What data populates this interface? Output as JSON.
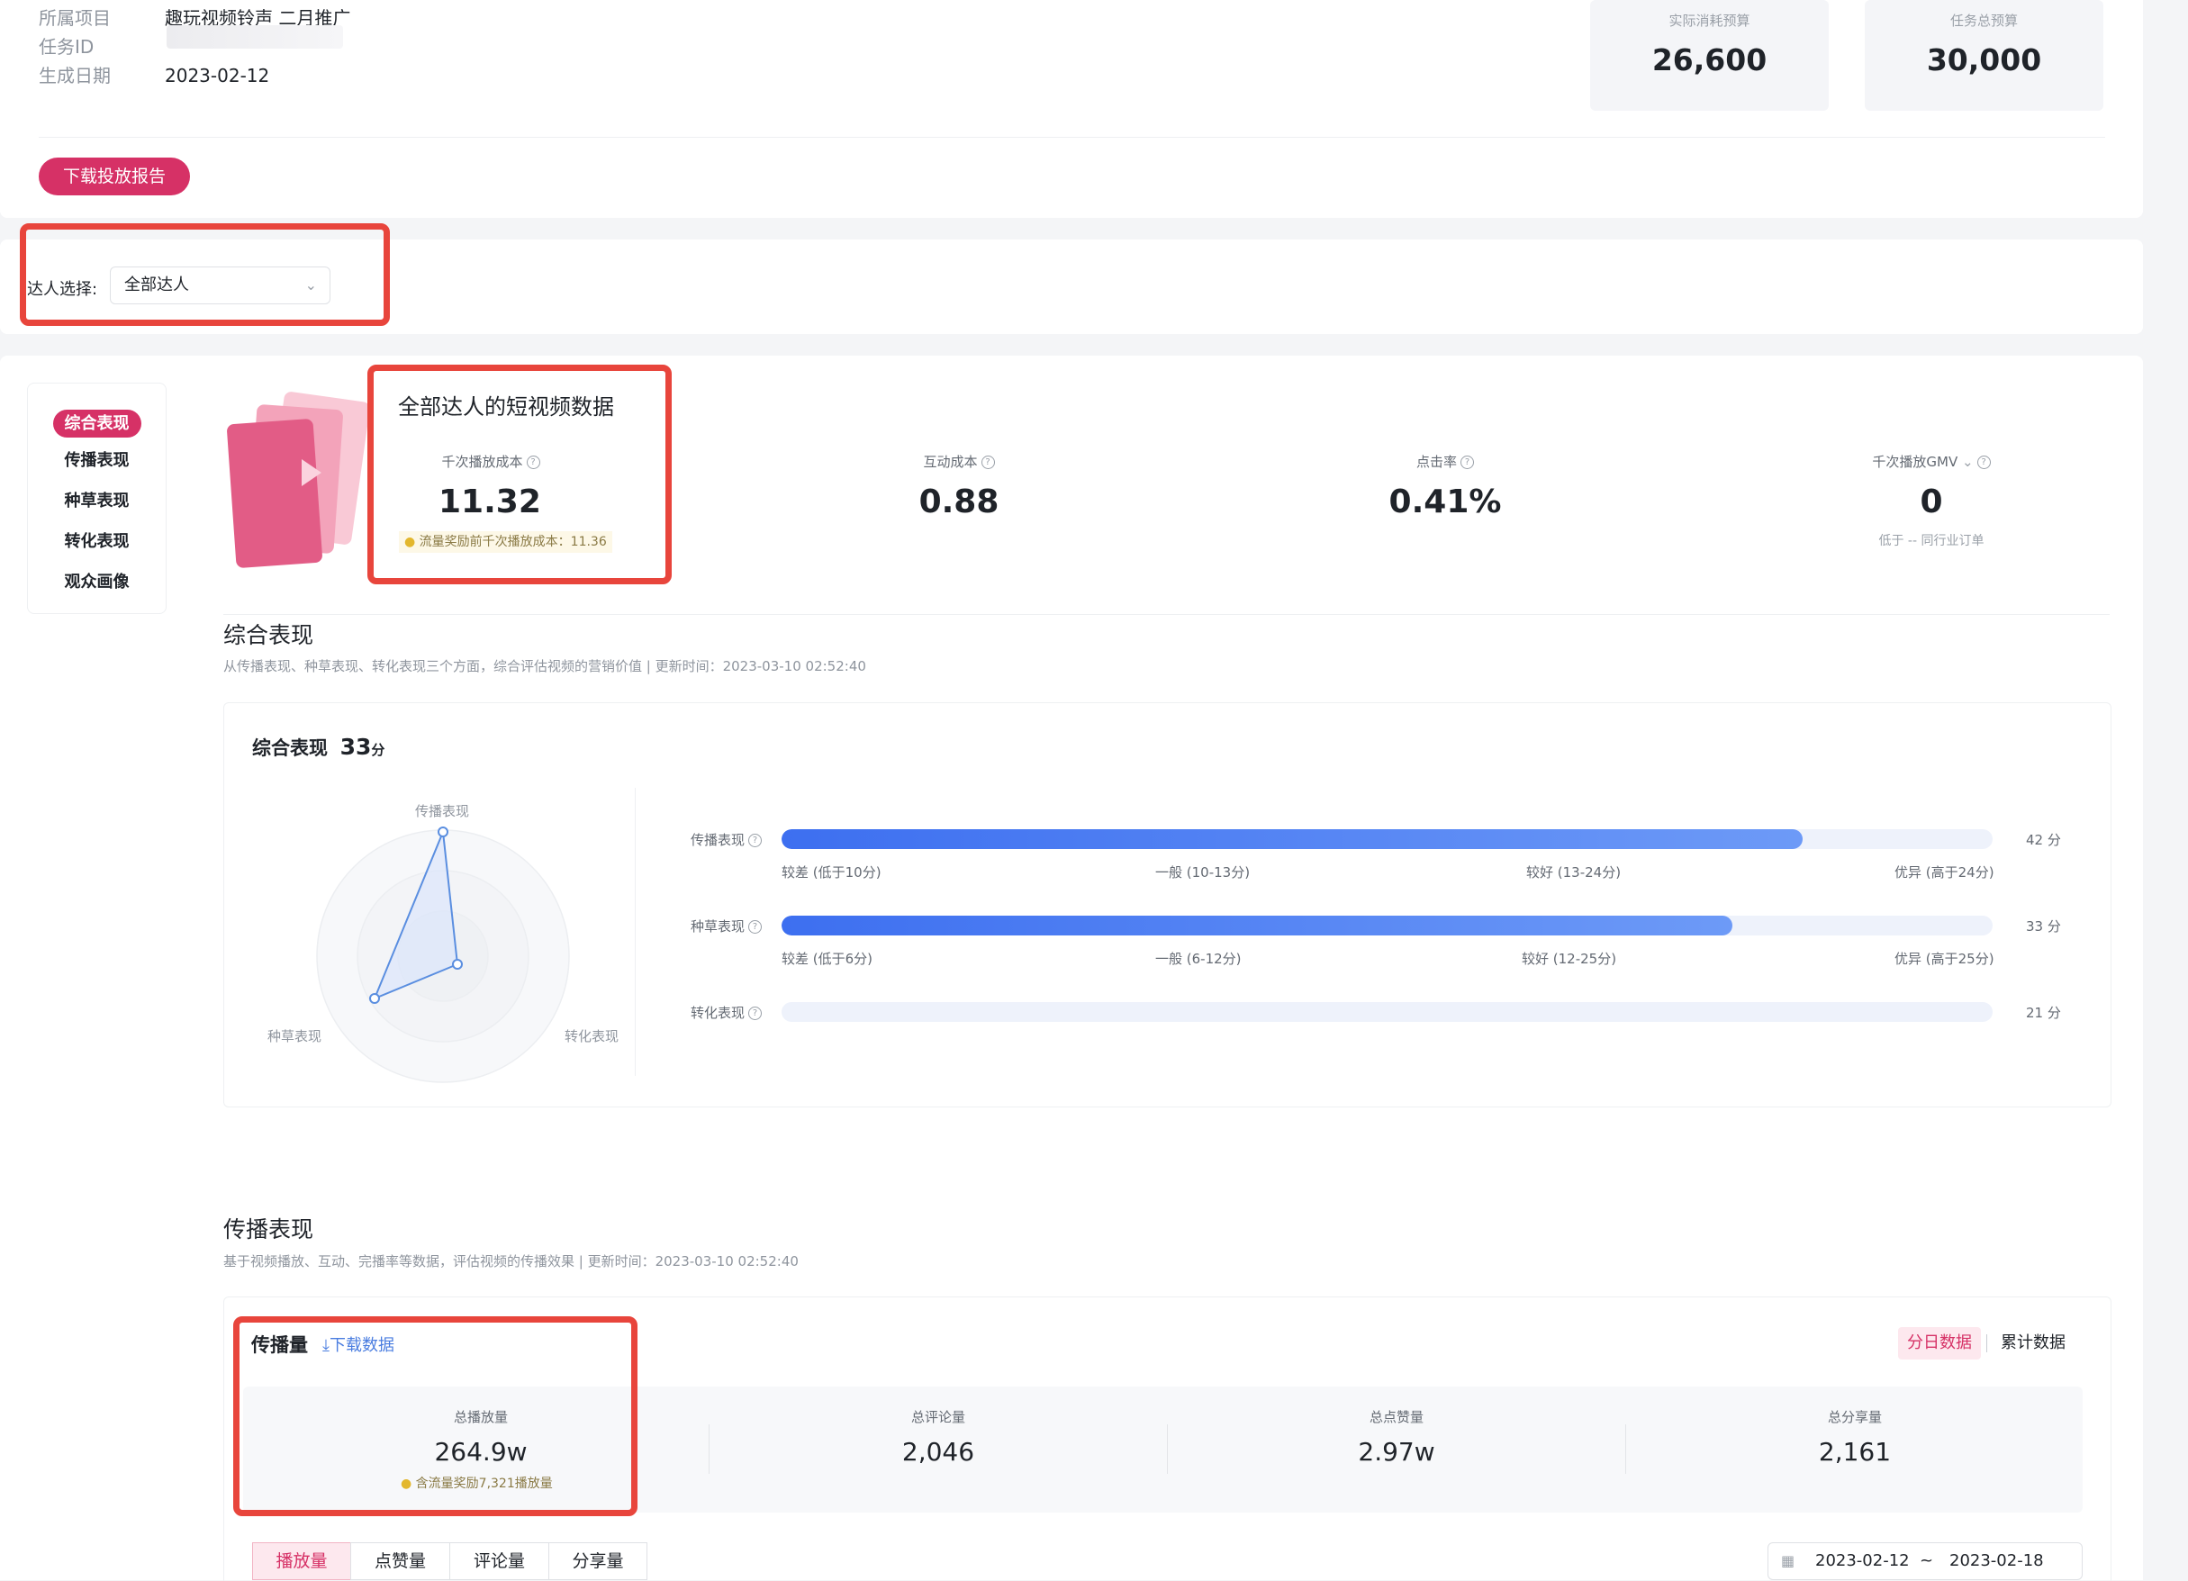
{
  "info": {
    "project_label": "所属项目",
    "project_value": "趣玩视频铃声 二月推广",
    "task_id_label": "任务ID",
    "date_label": "生成日期",
    "date_value": "2023-02-12"
  },
  "budgets": [
    {
      "label": "实际消耗预算",
      "value": "26,600"
    },
    {
      "label": "任务总预算",
      "value": "30,000"
    }
  ],
  "download_report": "下载投放报告",
  "filter": {
    "label": "达人选择:",
    "value": "全部达人"
  },
  "side_nav": [
    "综合表现",
    "传播表现",
    "种草表现",
    "转化表现",
    "观众画像"
  ],
  "summary": {
    "title": "全部达人的短视频数据",
    "metrics": [
      {
        "label": "千次播放成本",
        "value": "11.32",
        "note": "流量奖励前千次播放成本：11.36"
      },
      {
        "label": "互动成本",
        "value": "0.88"
      },
      {
        "label": "点击率",
        "value": "0.41%"
      },
      {
        "label": "千次播放GMV",
        "value": "0",
        "note": "低于 -- 同行业订单"
      }
    ]
  },
  "overall": {
    "title": "综合表现",
    "desc": "从传播表现、种草表现、转化表现三个方面，综合评估视频的营销价值 | 更新时间：2023-03-10 02:52:40",
    "score_title": "综合表现",
    "score_value": "33",
    "score_unit": "分",
    "radar_labels": [
      "传播表现",
      "种草表现",
      "转化表现"
    ],
    "radar_values": [
      42,
      33,
      21
    ],
    "bars": [
      {
        "label": "传播表现",
        "score_text": "42 分",
        "fill": 0.843,
        "ticks": [
          "较差 (低于10分)",
          "一般 (10-13分)",
          "较好 (13-24分)",
          "优异 (高于24分)"
        ]
      },
      {
        "label": "种草表现",
        "score_text": "33 分",
        "fill": 0.785,
        "ticks": [
          "较差 (低于6分)",
          "一般 (6-12分)",
          "较好 (12-25分)",
          "优异 (高于25分)"
        ]
      },
      {
        "label": "转化表现",
        "score_text": "21 分",
        "fill": 0,
        "ticks": []
      }
    ]
  },
  "spread": {
    "title": "传播表现",
    "desc": "基于视频播放、互动、完播率等数据，评估视频的传播效果 | 更新时间：2023-03-10 02:52:40",
    "card_title": "传播量",
    "download_data": "下载数据",
    "toggle_daily": "分日数据",
    "toggle_cumulative": "累计数据",
    "stats": [
      {
        "label": "总播放量",
        "value": "264.9w",
        "note": "含流量奖励7,321播放量"
      },
      {
        "label": "总评论量",
        "value": "2,046"
      },
      {
        "label": "总点赞量",
        "value": "2.97w"
      },
      {
        "label": "总分享量",
        "value": "2,161"
      }
    ],
    "tabs": [
      "播放量",
      "点赞量",
      "评论量",
      "分享量"
    ],
    "date_from": "2023-02-12",
    "date_sep": "~",
    "date_to": "2023-02-18"
  },
  "colors": {
    "brand": "#d63166",
    "bar": "#3d6ff0",
    "highlight": "#e8453c"
  }
}
